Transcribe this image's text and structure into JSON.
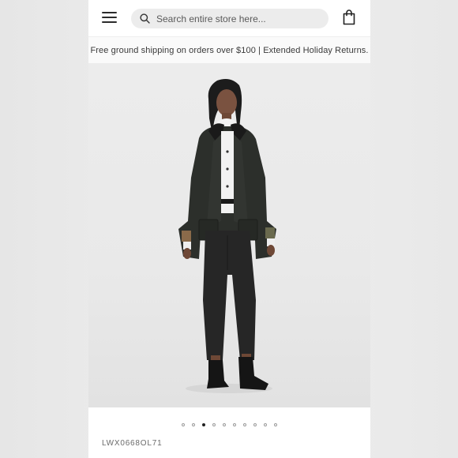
{
  "header": {
    "menu_icon": "hamburger-menu-icon",
    "search": {
      "placeholder": "Search entire store here...",
      "icon": "search-icon"
    },
    "cart_icon": "shopping-bag-icon"
  },
  "promo": {
    "text": "Free ground shipping on orders over $100 | Extended Holiday Returns."
  },
  "gallery": {
    "image_description": "model-wearing-dark-waxed-jacket",
    "total_slides": 10,
    "active_slide": 3
  },
  "product": {
    "sku": "LWX0668OL71"
  },
  "colors": {
    "page_bg": "#ececec",
    "jacket": "#2c2f2b",
    "accent": "#222222"
  }
}
